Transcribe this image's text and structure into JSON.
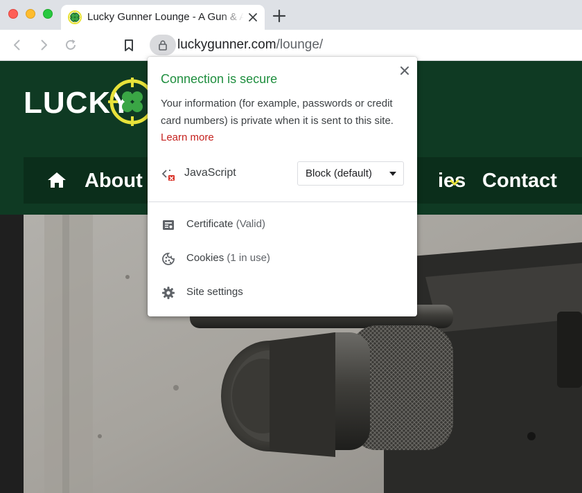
{
  "tab": {
    "title": "Lucky Gunner Lounge - A Gun & Ammo Blog"
  },
  "address": {
    "domain": "luckygunner.com",
    "path": "/lounge/"
  },
  "site": {
    "logo_text": "LUCKY",
    "nav": {
      "about": "About",
      "partial_item": "ies",
      "contact": "Contact"
    }
  },
  "popup": {
    "title": "Connection is secure",
    "description": "Your information (for example, passwords or credit card numbers) is private when it is sent to this site.",
    "learn_more": "Learn more",
    "permission": {
      "label": "JavaScript",
      "value": "Block (default)"
    },
    "rows": [
      {
        "label": "Certificate",
        "sub": "(Valid)"
      },
      {
        "label": "Cookies",
        "sub": "(1 in use)"
      },
      {
        "label": "Site settings",
        "sub": ""
      }
    ]
  },
  "colors": {
    "secure_green": "#1e8e3e",
    "learn_more_red": "#c5221f",
    "site_header_green": "#0f3a23",
    "logo_yellow": "#e8e23a"
  },
  "icons": {
    "tab_favicon": "clover-favicon-icon",
    "lock": "lock-icon",
    "bookmark": "bookmark-icon",
    "javascript": "javascript-blocked-icon",
    "certificate": "certificate-icon",
    "cookies": "cookie-icon",
    "settings": "gear-icon"
  }
}
